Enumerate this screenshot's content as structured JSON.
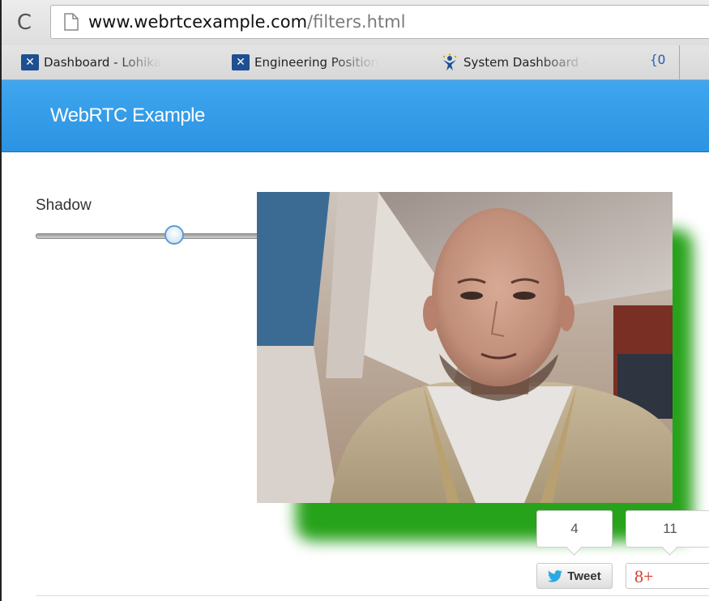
{
  "browser": {
    "url_domain": "www.webrtcexample.com",
    "url_path": "/filters.html",
    "bookmarks": [
      {
        "label": "Dashboard - Lohika"
      },
      {
        "label": "Engineering Position"
      },
      {
        "label": "System Dashboard -"
      }
    ],
    "bookmarks_overflow": "{O"
  },
  "navbar": {
    "brand": "WebRTC Example",
    "color": "#2b93e2"
  },
  "filter_control": {
    "label": "Shadow",
    "slider_value_fraction": 0.59
  },
  "video": {
    "shadow_color": "#27a21b"
  },
  "share": {
    "tweet_count": "4",
    "tweet_label": "Tweet",
    "gplus_count": "11",
    "gplus_label": "8+"
  }
}
